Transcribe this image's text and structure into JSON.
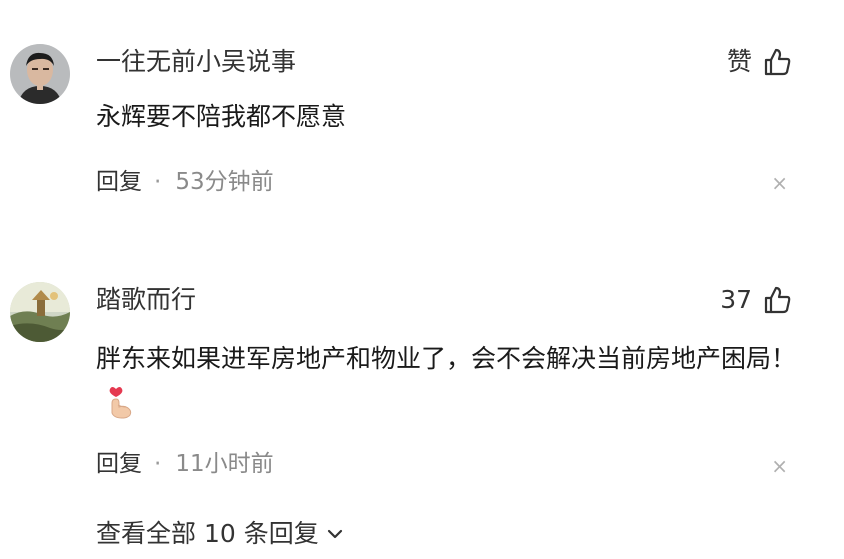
{
  "comments": [
    {
      "username": "一往无前小吴说事",
      "like_label": "赞",
      "text": "永辉要不陪我都不愿意",
      "reply_label": "回复",
      "separator": "·",
      "time": "53分钟前",
      "close_label": "×",
      "avatar_icon": "user-avatar-man"
    },
    {
      "username": "踏歌而行",
      "like_label": "37",
      "text": "胖东来如果进军房地产和物业了，会不会解决当前房地产困局！",
      "reply_label": "回复",
      "separator": "·",
      "time": "11小时前",
      "close_label": "×",
      "avatar_icon": "user-avatar-landscape",
      "emoji_icon": "finger-heart-emoji"
    }
  ],
  "expand_replies": {
    "label": "查看全部 10 条回复",
    "icon": "chevron-down-icon"
  },
  "colors": {
    "text_primary": "#1a1a1a",
    "text_secondary": "#8a8a8a",
    "close": "#b0b0b0"
  }
}
